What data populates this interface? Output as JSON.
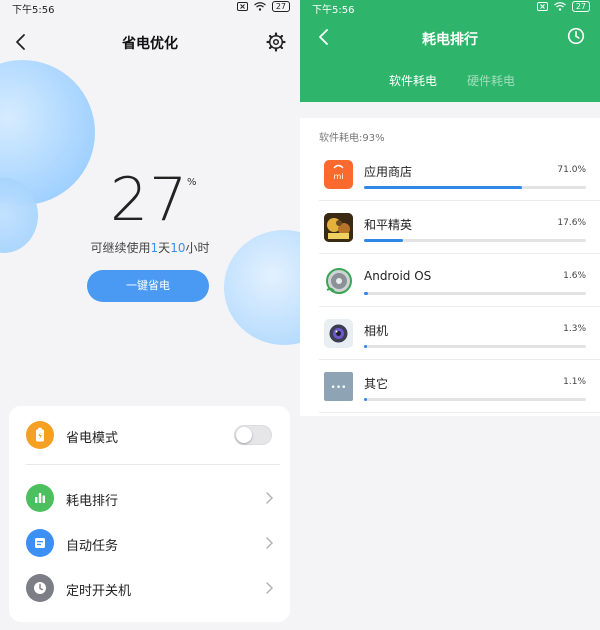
{
  "left": {
    "status": {
      "time": "下午5:56",
      "battery": "27"
    },
    "header": {
      "title": "省电优化"
    },
    "battery_level": "27",
    "percent_sign": "%",
    "remaining": {
      "prefix": "可继续使用",
      "days": "1",
      "day_unit": "天",
      "hours": "10",
      "hour_unit": "小时"
    },
    "save_button": "一键省电",
    "menu": {
      "power_mode": {
        "label": "省电模式",
        "toggle_on": false,
        "color": "#f5a023"
      },
      "ranking": {
        "label": "耗电排行",
        "color": "#4cc05e"
      },
      "auto_task": {
        "label": "自动任务",
        "color": "#3b8ff5"
      },
      "timer_power": {
        "label": "定时开关机",
        "color": "#7b7e85"
      }
    }
  },
  "right": {
    "status": {
      "time": "下午5:56",
      "battery": "27"
    },
    "header": {
      "title": "耗电排行"
    },
    "tabs": [
      {
        "label": "软件耗电",
        "active": true
      },
      {
        "label": "硬件耗电",
        "active": false
      }
    ],
    "summary": "软件耗电:93%",
    "apps": [
      {
        "name": "应用商店",
        "percent": "71.0%",
        "value": 71.0,
        "icon": "app-store-icon",
        "icon_text": "mi"
      },
      {
        "name": "和平精英",
        "percent": "17.6%",
        "value": 17.6,
        "icon": "peace-elite-game-icon"
      },
      {
        "name": "Android OS",
        "percent": "1.6%",
        "value": 1.6,
        "icon": "android-os-icon"
      },
      {
        "name": "相机",
        "percent": "1.3%",
        "value": 1.3,
        "icon": "camera-icon"
      },
      {
        "name": "其它",
        "percent": "1.1%",
        "value": 1.1,
        "icon": "others-icon",
        "icon_text": "•••"
      }
    ],
    "colors": {
      "header": "#2fb56b",
      "bar": "#2f88e8"
    }
  }
}
